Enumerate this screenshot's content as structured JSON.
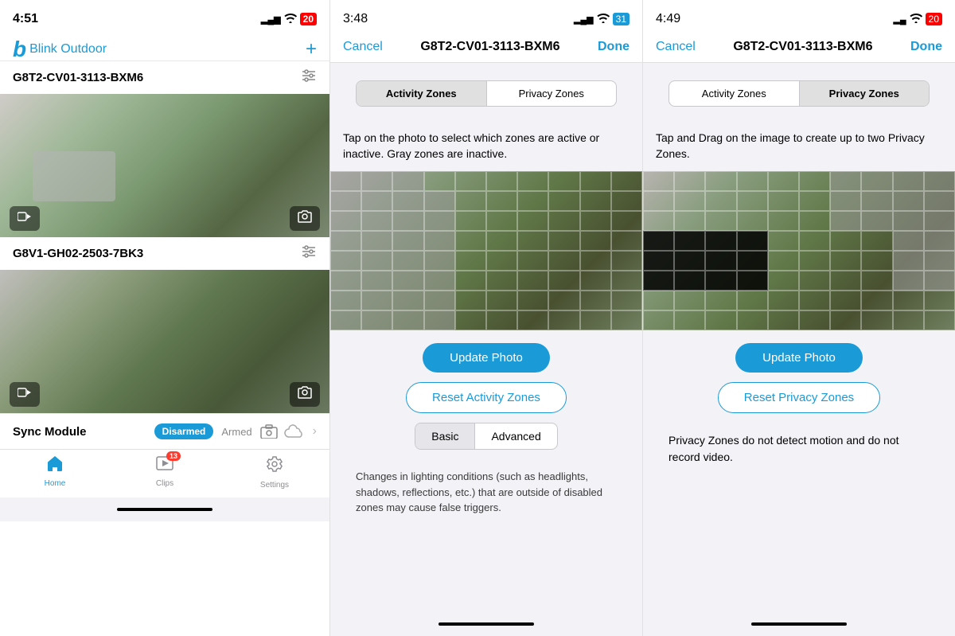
{
  "panels": {
    "home": {
      "status_bar": {
        "time": "4:51",
        "signal": "▂▄▆",
        "wifi": "WiFi",
        "battery": "20"
      },
      "header": {
        "logo_letter": "b",
        "app_name": "Blink Outdoor",
        "add_label": "+"
      },
      "cameras": [
        {
          "id": "cam1",
          "name": "G8T2-CV01-3113-BXM6",
          "video_icon": "□▶",
          "camera_icon": "📷"
        },
        {
          "id": "cam2",
          "name": "G8V1-GH02-2503-7BK3",
          "video_icon": "□▶",
          "camera_icon": "📷"
        }
      ],
      "sync_module": {
        "label": "Sync Module",
        "status_disarmed": "Disarmed",
        "status_armed": "Armed"
      },
      "tabs": [
        {
          "id": "home",
          "label": "Home",
          "icon": "⌂",
          "active": true
        },
        {
          "id": "clips",
          "label": "Clips",
          "icon": "▶",
          "badge": "13",
          "active": false
        },
        {
          "id": "settings",
          "label": "Settings",
          "icon": "⚙",
          "active": false
        }
      ]
    },
    "activity": {
      "status_bar": {
        "time": "3:48"
      },
      "nav": {
        "cancel": "Cancel",
        "title": "G8T2-CV01-3113-BXM6",
        "done": "Done"
      },
      "tabs": [
        {
          "id": "activity",
          "label": "Activity Zones",
          "active": true
        },
        {
          "id": "privacy",
          "label": "Privacy Zones",
          "active": false
        }
      ],
      "instruction": "Tap on the photo to select which zones are active or inactive. Gray zones are inactive.",
      "buttons": {
        "update_photo": "Update Photo",
        "reset": "Reset Activity Zones"
      },
      "mode_buttons": [
        {
          "id": "basic",
          "label": "Basic",
          "active": true
        },
        {
          "id": "advanced",
          "label": "Advanced",
          "active": false
        }
      ],
      "footer_text": "Changes in lighting conditions (such as headlights, shadows, reflections, etc.) that are outside of disabled zones may cause false triggers."
    },
    "privacy": {
      "status_bar": {
        "time": "4:49"
      },
      "nav": {
        "cancel": "Cancel",
        "title": "G8T2-CV01-3113-BXM6",
        "done": "Done"
      },
      "tabs": [
        {
          "id": "activity",
          "label": "Activity Zones",
          "active": false
        },
        {
          "id": "privacy",
          "label": "Privacy Zones",
          "active": true
        }
      ],
      "instruction": "Tap and Drag on the image to create up to two Privacy Zones.",
      "buttons": {
        "update_photo": "Update Photo",
        "reset": "Reset Privacy Zones"
      },
      "privacy_note": "Privacy Zones do not detect motion and do not record video."
    }
  }
}
